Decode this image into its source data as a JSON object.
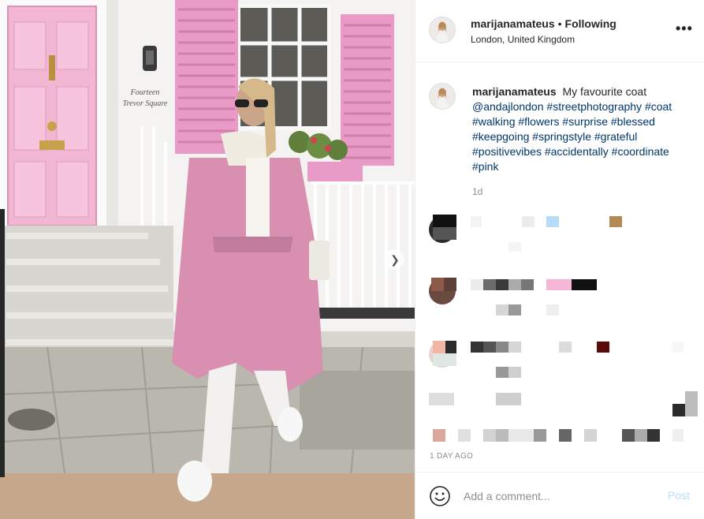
{
  "post": {
    "username": "marijanamateus",
    "follow_status": "Following",
    "separator": "•",
    "location": "London, United Kingdom",
    "more_label": "•••"
  },
  "photo": {
    "sign_line1": "Fourteen",
    "sign_line2": "Trevor Square",
    "next_icon": "chevron-right-icon"
  },
  "caption": {
    "username": "marijanamateus",
    "text": "My favourite coat",
    "tags": [
      "@andajlondon",
      "#streetphotography",
      "#coat",
      "#walking",
      "#flowers",
      "#surprise",
      "#blessed",
      "#keepgoing",
      "#springstyle",
      "#grateful",
      "#positivevibes",
      "#accidentally",
      "#coordinate",
      "#pink"
    ],
    "age": "1d"
  },
  "timestamp": "1 DAY AGO",
  "comment_box": {
    "placeholder": "Add a comment...",
    "post_label": "Post",
    "emoji_icon": "smiley-icon"
  },
  "colors": {
    "door": "#f2b6d3",
    "shutter": "#e89bc6",
    "coat": "#d98fb0",
    "link": "#00376b",
    "post_disabled": "#b2dffc"
  }
}
